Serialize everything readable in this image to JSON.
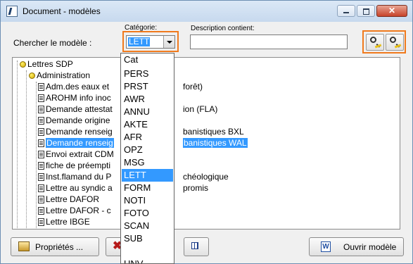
{
  "window": {
    "title": "Document - modèles"
  },
  "search": {
    "label": "Chercher le modèle :",
    "category_label": "Catégorie:",
    "category_value": "LETT",
    "description_label": "Description contient:",
    "description_value": ""
  },
  "tree": {
    "root": "Lettres SDP",
    "group": "Administration",
    "items": [
      {
        "left": "Adm.des eaux et",
        "right": "forêt)"
      },
      {
        "left": "AROHM info inoc",
        "right": ""
      },
      {
        "left": "Demande attestat",
        "right": "ion (FLA)"
      },
      {
        "left": "Demande origine",
        "right": ""
      },
      {
        "left": "Demande renseig",
        "right": "banistiques BXL"
      },
      {
        "left": "Demande renseig",
        "right": "banistiques WAL",
        "selected": true
      },
      {
        "left": "Envoi extrait CDM",
        "right": ""
      },
      {
        "left": "fiche de préempti",
        "right": ""
      },
      {
        "left": "Inst.flamand du P",
        "right": "chéologique"
      },
      {
        "left": "Lettre au syndic a",
        "right": "promis"
      },
      {
        "left": "Lettre DAFOR",
        "right": ""
      },
      {
        "left": "Lettre DAFOR - c",
        "right": ""
      },
      {
        "left": "Lettre IBGE",
        "right": ""
      }
    ]
  },
  "dropdown": {
    "options": [
      "Cat",
      "",
      "PERS",
      "PRST",
      "AWR",
      "ANNU",
      "AKTE",
      "AFR",
      "OPZ",
      "MSG",
      "LETT",
      "FORM",
      "NOTI",
      "FOTO",
      "SCAN",
      "SUB",
      "",
      "HNV"
    ],
    "selected": "LETT"
  },
  "buttons": {
    "properties": "Propriétés ...",
    "open": "Ouvrir modèle"
  },
  "colors": {
    "highlight": "#3399ff",
    "accent_outline": "#f07a1d"
  }
}
